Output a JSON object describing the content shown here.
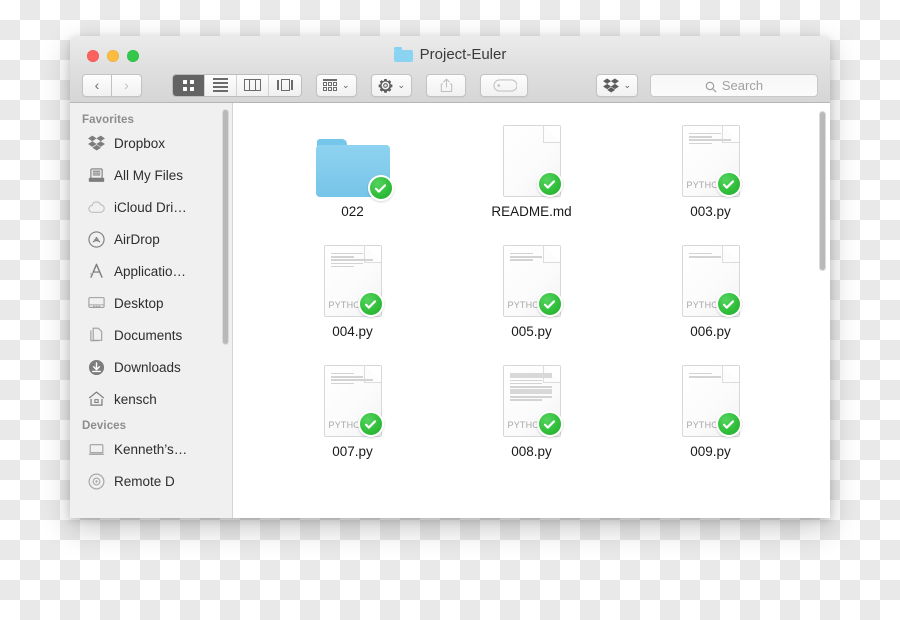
{
  "window": {
    "title": "Project-Euler",
    "title_icon": "folder-icon",
    "traffic_lights": [
      {
        "name": "close",
        "color": "#fc615d"
      },
      {
        "name": "minimize",
        "color": "#fdbc40"
      },
      {
        "name": "maximize",
        "color": "#34c84a"
      }
    ]
  },
  "toolbar": {
    "back_label": "‹",
    "forward_label": "›",
    "view_buttons": [
      {
        "name": "icon-view",
        "icon": "grid-icon",
        "active": true
      },
      {
        "name": "list-view",
        "icon": "list-icon",
        "active": false
      },
      {
        "name": "column-view",
        "icon": "columns-icon",
        "active": false
      },
      {
        "name": "coverflow-view",
        "icon": "coverflow-icon",
        "active": false
      }
    ],
    "arrange_icon": "arrange-grid-icon",
    "action_icon": "gear-icon",
    "share_icon": "share-icon",
    "tag_icon": "tag-icon",
    "dropbox_icon": "dropbox-icon",
    "caret": "⌄",
    "search": {
      "placeholder": "Search",
      "icon": "search-icon",
      "value": ""
    }
  },
  "sidebar": {
    "sections": [
      {
        "header": "Favorites",
        "items": [
          {
            "label": "Dropbox",
            "icon": "dropbox-icon"
          },
          {
            "label": "All My Files",
            "icon": "all-my-files-icon"
          },
          {
            "label": "iCloud Dri…",
            "icon": "icloud-icon"
          },
          {
            "label": "AirDrop",
            "icon": "airdrop-icon"
          },
          {
            "label": "Applicatio…",
            "icon": "applications-icon"
          },
          {
            "label": "Desktop",
            "icon": "desktop-icon"
          },
          {
            "label": "Documents",
            "icon": "documents-icon"
          },
          {
            "label": "Downloads",
            "icon": "downloads-icon"
          },
          {
            "label": "kensch",
            "icon": "home-icon"
          }
        ]
      },
      {
        "header": "Devices",
        "items": [
          {
            "label": "Kenneth’s…",
            "icon": "laptop-icon"
          },
          {
            "label": "Remote D",
            "icon": "disc-icon"
          }
        ]
      }
    ]
  },
  "files": [
    {
      "name": "022",
      "kind": "folder",
      "type_label": "",
      "badge": "synced-check",
      "lines": "none"
    },
    {
      "name": "README.md",
      "kind": "document",
      "type_label": "",
      "badge": "synced-check",
      "lines": "none"
    },
    {
      "name": "003.py",
      "kind": "document",
      "type_label": "PYTHON",
      "badge": "synced-check",
      "lines": "few"
    },
    {
      "name": "004.py",
      "kind": "document",
      "type_label": "PYTHON",
      "badge": "synced-check",
      "lines": "few"
    },
    {
      "name": "005.py",
      "kind": "document",
      "type_label": "PYTHON",
      "badge": "synced-check",
      "lines": "few"
    },
    {
      "name": "006.py",
      "kind": "document",
      "type_label": "PYTHON",
      "badge": "synced-check",
      "lines": "few"
    },
    {
      "name": "007.py",
      "kind": "document",
      "type_label": "PYTHON",
      "badge": "synced-check",
      "lines": "few"
    },
    {
      "name": "008.py",
      "kind": "document",
      "type_label": "PYTHON",
      "badge": "synced-check",
      "lines": "many"
    },
    {
      "name": "009.py",
      "kind": "document",
      "type_label": "PYTHON",
      "badge": "synced-check",
      "lines": "few"
    }
  ],
  "colors": {
    "folder_blue": "#8ad4f2",
    "badge_green": "#31bf3b",
    "sidebar_bg": "#f0f0f0",
    "toolbar_bg": "#dedede",
    "active_view_bg": "#636363"
  }
}
